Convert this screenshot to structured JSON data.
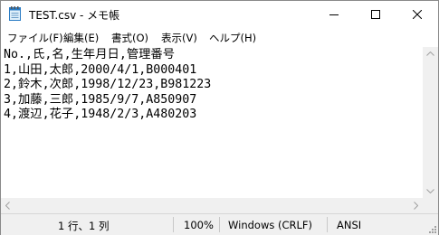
{
  "window": {
    "title": "TEST.csv - メモ帳",
    "icons": {
      "app": "notepad-icon",
      "minimize": "minimize-icon",
      "maximize": "maximize-icon",
      "close": "close-icon"
    }
  },
  "menu": {
    "items": [
      {
        "label": "ファイル(F)"
      },
      {
        "label": "編集(E)"
      },
      {
        "label": "書式(O)"
      },
      {
        "label": "表示(V)"
      },
      {
        "label": "ヘルプ(H)"
      }
    ]
  },
  "editor": {
    "content": "No.,氏,名,生年月日,管理番号\n1,山田,太郎,2000/4/1,B000401\n2,鈴木,次郎,1998/12/23,B981223\n3,加藤,三郎,1985/9/7,A850907\n4,渡辺,花子,1948/2/3,A480203"
  },
  "statusbar": {
    "position": "1 行、1 列",
    "zoom": "100%",
    "line_ending": "Windows (CRLF)",
    "encoding": "ANSI"
  },
  "colors": {
    "chrome_bg": "#f0f0f0",
    "editor_bg": "#ffffff",
    "text": "#000000"
  }
}
